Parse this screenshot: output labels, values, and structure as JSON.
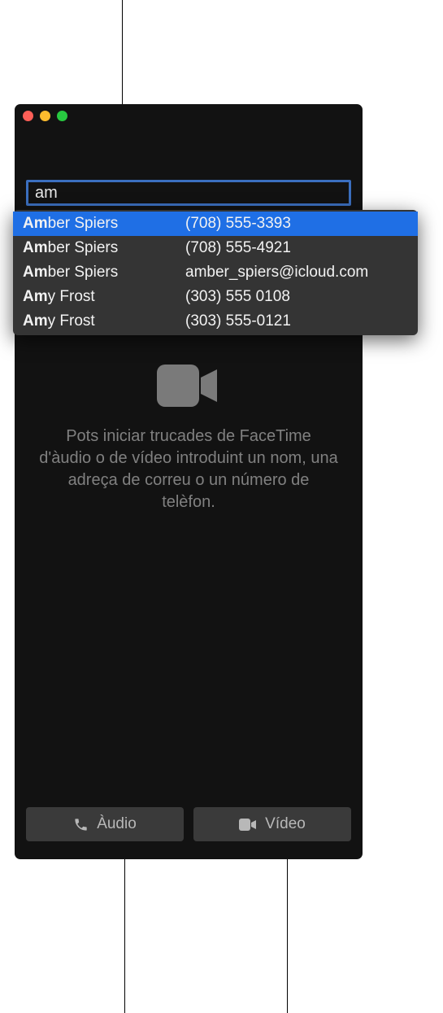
{
  "search": {
    "value": "am",
    "placeholder": ""
  },
  "suggestions": [
    {
      "name_prefix": "Am",
      "name_rest": "ber Spiers",
      "contact": "(708) 555-3393",
      "selected": true
    },
    {
      "name_prefix": "Am",
      "name_rest": "ber Spiers",
      "contact": "(708) 555-4921",
      "selected": false
    },
    {
      "name_prefix": "Am",
      "name_rest": "ber Spiers",
      "contact": "amber_spiers@icloud.com",
      "selected": false
    },
    {
      "name_prefix": "Am",
      "name_rest": "y Frost",
      "contact": "(303) 555 0108",
      "selected": false
    },
    {
      "name_prefix": "Am",
      "name_rest": "y Frost",
      "contact": "(303) 555-0121",
      "selected": false
    }
  ],
  "instructions": "Pots iniciar trucades de FaceTime d'àudio o de vídeo introduint un nom, una adreça de correu o un número de telèfon.",
  "buttons": {
    "audio_label": "Àudio",
    "video_label": "Vídeo"
  }
}
